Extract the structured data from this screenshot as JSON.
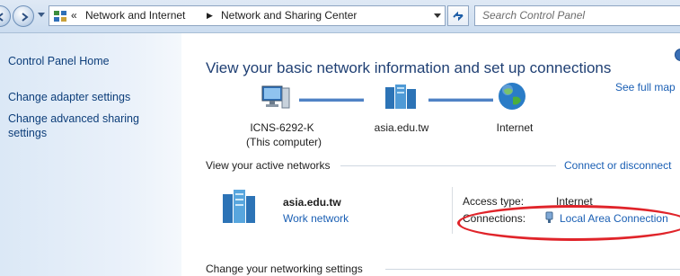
{
  "address_bar": {
    "overflow_chevron": "«",
    "breadcrumbs": [
      "Network and Internet",
      "Network and Sharing Center"
    ],
    "search_placeholder": "Search Control Panel"
  },
  "sidebar": {
    "home": "Control Panel Home",
    "items": [
      "Change adapter settings",
      "Change advanced sharing settings"
    ]
  },
  "main": {
    "title": "View your basic network information and set up connections",
    "see_full_map": "See full map",
    "nodes": [
      {
        "name": "ICNS-6292-K",
        "sub": "(This computer)",
        "icon": "computer-icon"
      },
      {
        "name": "asia.edu.tw",
        "sub": "",
        "icon": "domain-network-icon"
      },
      {
        "name": "Internet",
        "sub": "",
        "icon": "globe-icon"
      }
    ],
    "active_networks_label": "View your active networks",
    "connect_disconnect": "Connect or disconnect",
    "network": {
      "name": "asia.edu.tw",
      "type": "Work network",
      "access_type_label": "Access type:",
      "access_type_value": "Internet",
      "connections_label": "Connections:",
      "connection_value": "Local Area Connection"
    },
    "change_settings_label": "Change your networking settings"
  },
  "colors": {
    "accent": "#1a5fb4",
    "title": "#1f3f73",
    "highlight": "#e0242a"
  }
}
